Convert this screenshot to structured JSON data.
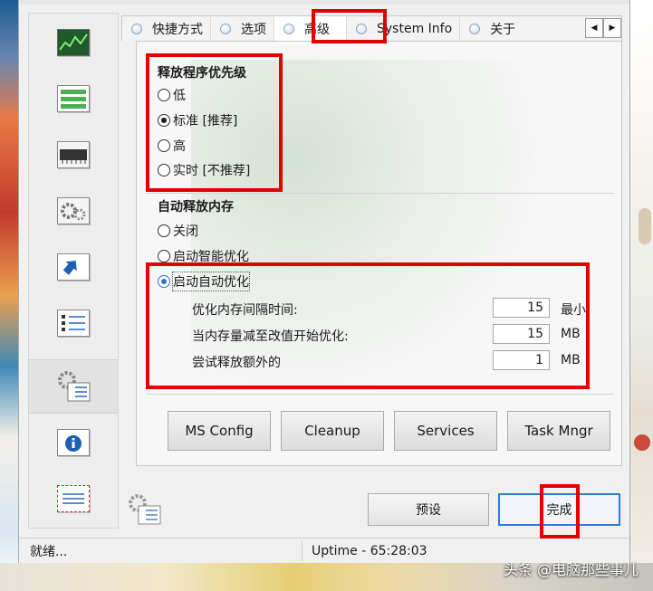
{
  "tabs": [
    {
      "label": "快捷方式"
    },
    {
      "label": "选项"
    },
    {
      "label": "高级",
      "active": true
    },
    {
      "label": "System Info"
    },
    {
      "label": "关于"
    }
  ],
  "tab_scroll": {
    "left": "◀",
    "right": "▶"
  },
  "sidebar": {
    "icons": [
      "chart-icon",
      "list-icon",
      "memory-chip-icon",
      "gears-icon",
      "shortcut-arrow-icon",
      "checklist-icon",
      "settings-checklist-icon",
      "info-icon",
      "mail-icon"
    ],
    "active_index": 6
  },
  "priority": {
    "title": "释放程序优先级",
    "options": [
      "低",
      "标准 [推荐]",
      "高",
      "实时 [不推荐]"
    ],
    "selected_index": 1
  },
  "auto_release": {
    "title": "自动释放内存",
    "options": [
      "关闭",
      "启动智能优化",
      "启动自动优化"
    ],
    "selected_index": 2
  },
  "fields": [
    {
      "label": "优化内存间隔时间:",
      "value": "15",
      "unit": "最小"
    },
    {
      "label": "当内存量减至改值开始优化:",
      "value": "15",
      "unit": "MB"
    },
    {
      "label": "尝试释放额外的",
      "value": "1",
      "unit": "MB"
    }
  ],
  "actions": [
    "MS Config",
    "Cleanup",
    "Services",
    "Task Mngr"
  ],
  "footer": {
    "preset_label": "预设",
    "done_label": "完成"
  },
  "status": {
    "left": "就绪...",
    "right": "Uptime - 65:28:03"
  },
  "watermark": "头条 @电脑那些事儿",
  "colors": {
    "highlight": "#e00000",
    "accent": "#2f7ad6"
  }
}
